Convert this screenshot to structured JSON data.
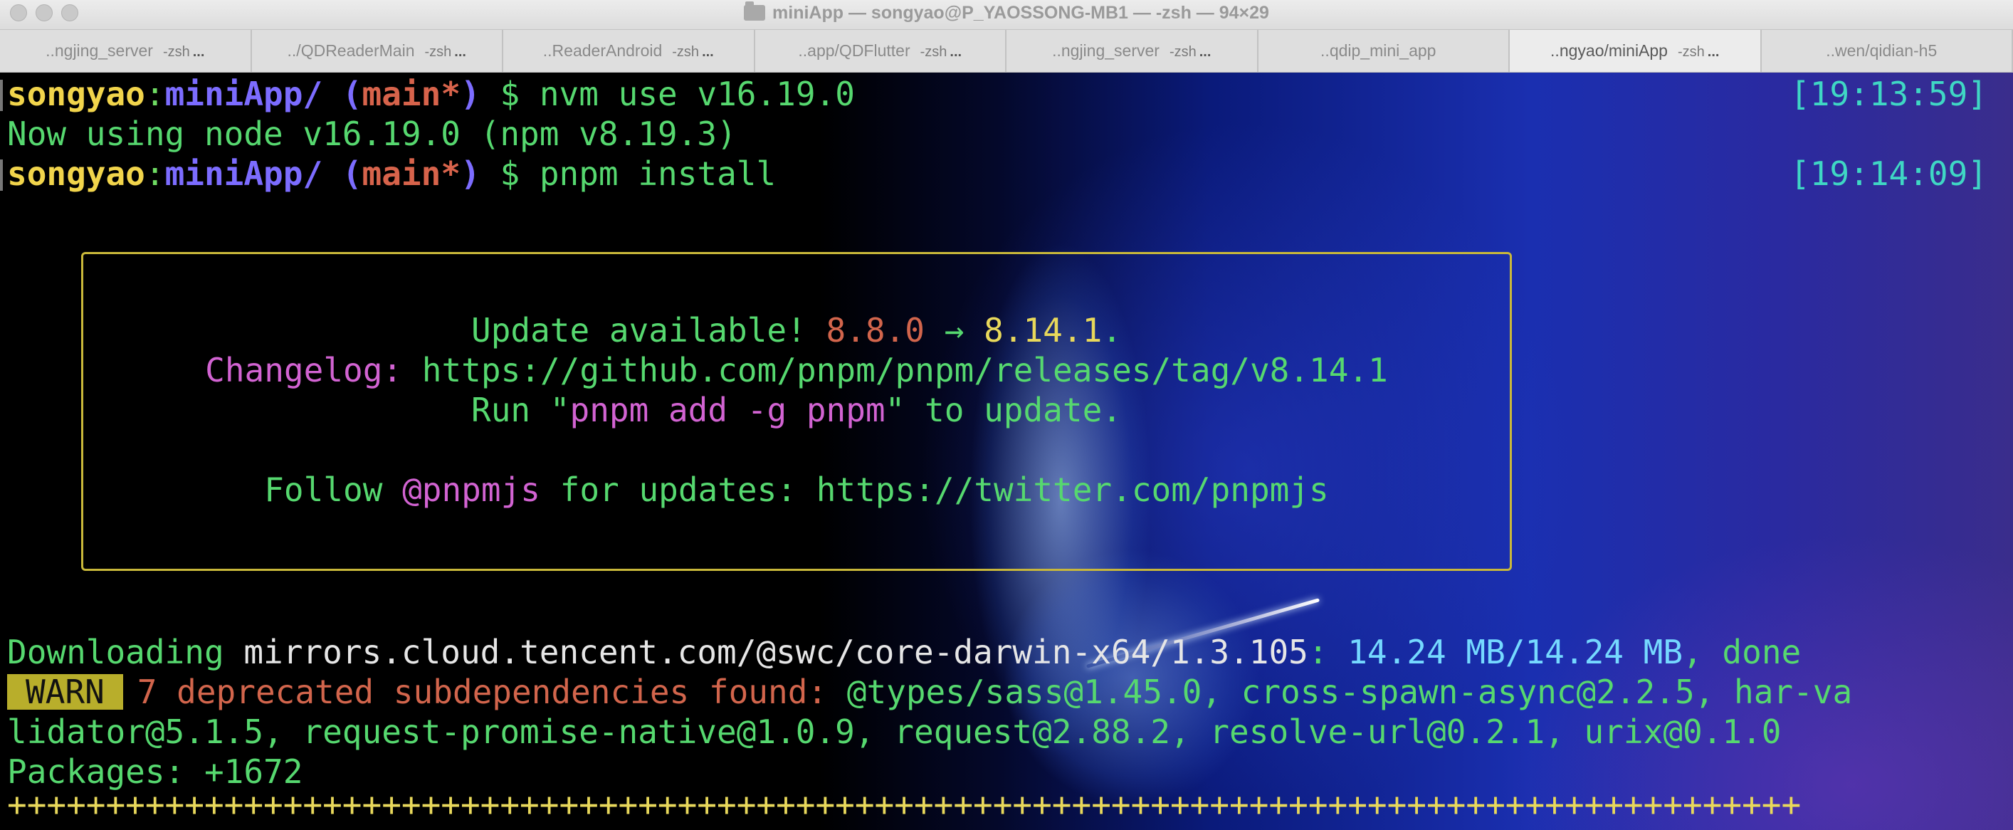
{
  "window": {
    "title": "miniApp — songyao@P_YAOSSONG-MB1 — -zsh — 94×29"
  },
  "tabs": [
    {
      "name": "..ngjing_server",
      "proc": "-zsh",
      "more": "...",
      "active": false
    },
    {
      "name": "../QDReaderMain",
      "proc": "-zsh",
      "more": "...",
      "active": false
    },
    {
      "name": "..ReaderAndroid",
      "proc": "-zsh",
      "more": "...",
      "active": false
    },
    {
      "name": "..app/QDFlutter",
      "proc": "-zsh",
      "more": "...",
      "active": false
    },
    {
      "name": "..ngjing_server",
      "proc": "-zsh",
      "more": "...",
      "active": false
    },
    {
      "name": "..qdip_mini_app",
      "proc": "",
      "more": "",
      "active": false
    },
    {
      "name": "..ngyao/miniApp",
      "proc": "-zsh",
      "more": "...",
      "active": true
    },
    {
      "name": "..wen/qidian-h5",
      "proc": "",
      "more": "",
      "active": false
    }
  ],
  "terminal": {
    "prompt1": {
      "user": "songyao",
      "colon": ":",
      "dir": "miniApp/",
      "paren_open": "(",
      "branch": "main*",
      "paren_close": ")",
      "dollar": "$",
      "command": "nvm use v16.19.0",
      "time": "[19:13:59]"
    },
    "output1": "Now using node v16.19.0 (npm v8.19.3)",
    "prompt2": {
      "user": "songyao",
      "colon": ":",
      "dir": "miniApp/",
      "paren_open": "(",
      "branch": "main*",
      "paren_close": ")",
      "dollar": "$",
      "command": "pnpm install",
      "time": "[19:14:09]"
    },
    "update_box": {
      "line1_prefix": "Update available! ",
      "old_version": "8.8.0",
      "arrow": " → ",
      "new_version": "8.14.1",
      "line1_suffix": ".",
      "changelog_label": "Changelog: ",
      "changelog_url": "https://github.com/pnpm/pnpm/releases/tag/v8.14.1",
      "run_prefix": "Run \"",
      "run_cmd": "pnpm add -g pnpm",
      "run_suffix": "\" to update.",
      "follow_prefix": "Follow ",
      "follow_handle": "@pnpmjs",
      "follow_mid": " for updates: ",
      "follow_url": "https://twitter.com/pnpmjs"
    },
    "download": {
      "label": "Downloading ",
      "url": "mirrors.cloud.tencent.com/@swc/core-darwin-x64/1.3.105",
      "sep": ": ",
      "size": "14.24 MB/14.24 MB",
      "status": ", done"
    },
    "warn": {
      "badge": "WARN",
      "message": "7 deprecated subdependencies found: ",
      "deps_line1": "@types/sass@1.45.0, cross-spawn-async@2.2.5, har-va",
      "deps_line2": "lidator@5.1.5, request-promise-native@1.0.9, request@2.88.2, resolve-url@0.2.1, urix@0.1.0"
    },
    "packages": "Packages: +1672",
    "progress_bar": "+++++++++++++++++++++++++++++++++++++++++++++++++++++++++++++++++++++++++++++++++++++++++++"
  },
  "colors": {
    "user": "#f1d44b",
    "dir": "#7c6cff",
    "branch": "#d7634b",
    "command": "#56d86f",
    "timestamp": "#3fd7c4",
    "warn_badge": "#b8ae2b",
    "box_border": "#c9b83a"
  }
}
